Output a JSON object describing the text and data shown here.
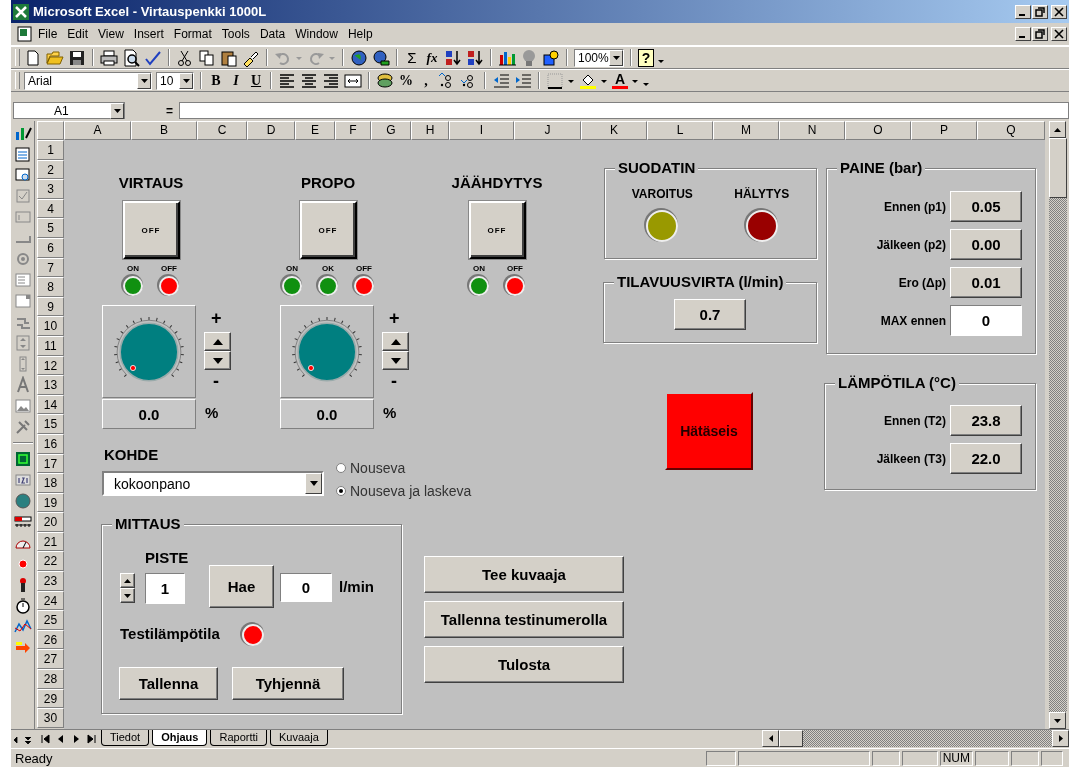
{
  "window": {
    "title": "Microsoft Excel - Virtauspenkki 1000L"
  },
  "menu": [
    "File",
    "Edit",
    "View",
    "Insert",
    "Format",
    "Tools",
    "Data",
    "Window",
    "Help"
  ],
  "standard_toolbar": {
    "sum": "Σ",
    "function": "fx",
    "zoom": "100%",
    "help": "?"
  },
  "format_toolbar": {
    "font": "Arial",
    "size": "10",
    "bold": "B",
    "italic": "I",
    "underline": "U",
    "percent": "%",
    "comma": ",",
    "font_color": "A"
  },
  "formula_bar": {
    "cell": "A1",
    "equals": "="
  },
  "columns": [
    "A",
    "B",
    "C",
    "D",
    "E",
    "F",
    "G",
    "H",
    "I",
    "J",
    "K",
    "L",
    "M",
    "N",
    "O",
    "P",
    "Q"
  ],
  "rows": [
    "1",
    "2",
    "3",
    "4",
    "5",
    "6",
    "7",
    "8",
    "9",
    "10",
    "11",
    "12",
    "13",
    "14",
    "15",
    "16",
    "17",
    "18",
    "19",
    "20",
    "21",
    "22",
    "23",
    "24",
    "25",
    "26",
    "27",
    "28",
    "29",
    "30"
  ],
  "switches": [
    {
      "title": "VIRTAUS",
      "button": "OFF",
      "on": false,
      "lamps": [
        {
          "label": "ON",
          "color": "#109010"
        },
        {
          "label": "OFF",
          "color": "#ff0000"
        }
      ]
    },
    {
      "title": "PROPO",
      "button": "OFF",
      "on": false,
      "lamps": [
        {
          "label": "ON",
          "color": "#109010"
        },
        {
          "label": "OK",
          "color": "#109010"
        },
        {
          "label": "OFF",
          "color": "#ff0000"
        }
      ]
    },
    {
      "title": "JÄÄHDYTYS",
      "button": "OFF",
      "on": false,
      "lamps": [
        {
          "label": "ON",
          "color": "#109010"
        },
        {
          "label": "OFF",
          "color": "#ff0000"
        }
      ]
    }
  ],
  "dials": [
    {
      "value": "0.0",
      "unit": "%",
      "plus": "+",
      "minus": "-"
    },
    {
      "value": "0.0",
      "unit": "%",
      "plus": "+",
      "minus": "-"
    }
  ],
  "kohde": {
    "label": "KOHDE",
    "value": "kokoonpano",
    "options": [
      {
        "label": "Nouseva",
        "selected": false
      },
      {
        "label": "Nouseva ja laskeva",
        "selected": true
      }
    ]
  },
  "suodatin": {
    "title": "SUODATIN",
    "lamps": [
      {
        "label": "VAROITUS",
        "color": "#999900"
      },
      {
        "label": "HÄLYTYS",
        "color": "#990000"
      }
    ]
  },
  "tilavuusvirta": {
    "title": "TILAVUUSVIRTA (l/min)",
    "value": "0.7"
  },
  "paine": {
    "title": "PAINE (bar)",
    "rows": [
      {
        "label": "Ennen (p1)",
        "value": "0.05",
        "kind": "readout"
      },
      {
        "label": "Jälkeen (p2)",
        "value": "0.00",
        "kind": "readout"
      },
      {
        "label": "Ero (Δp)",
        "value": "0.01",
        "kind": "readout"
      },
      {
        "label": "MAX ennen",
        "value": "0",
        "kind": "input"
      }
    ]
  },
  "emergency": {
    "label": "Hätäseis"
  },
  "lampotila": {
    "title": "LÄMPÖTILA (°C)",
    "rows": [
      {
        "label": "Ennen (T2)",
        "value": "23.8"
      },
      {
        "label": "Jälkeen (T3)",
        "value": "22.0"
      }
    ]
  },
  "mittaus": {
    "title": "MITTAUS",
    "point_label": "PISTE",
    "point": "1",
    "fetch": "Hae",
    "flow": "0",
    "unit": "l/min",
    "test_label": "Testilämpötila",
    "test_lamp": {
      "color": "#ff0000"
    },
    "buttons": [
      "Tallenna",
      "Tyhjennä"
    ]
  },
  "actions": [
    "Tee kuvaaja",
    "Tallenna testinumerolla",
    "Tulosta"
  ],
  "sheet_tabs": [
    {
      "label": "Tiedot",
      "selected": false
    },
    {
      "label": "Ohjaus",
      "selected": true
    },
    {
      "label": "Raportti",
      "selected": false
    },
    {
      "label": "Kuvaaja",
      "selected": false
    }
  ],
  "status_bar": {
    "text": "Ready",
    "indicators": [
      "NUM"
    ]
  }
}
